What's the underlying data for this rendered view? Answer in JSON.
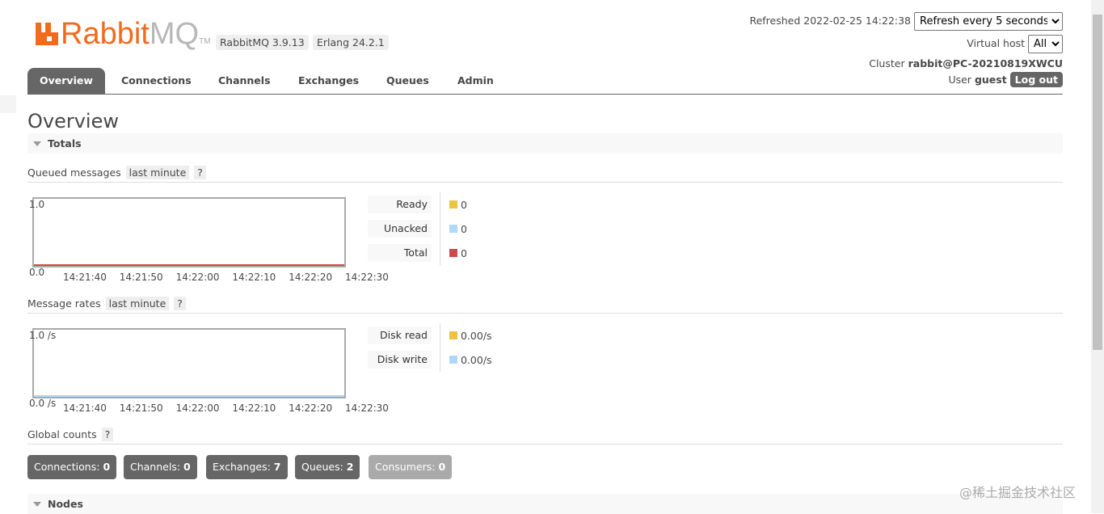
{
  "header": {
    "logo_text_a": "Rabbit",
    "logo_text_b": "MQ",
    "logo_tm": "TM",
    "rabbitmq_version": "RabbitMQ 3.9.13",
    "erlang_version": "Erlang 24.2.1",
    "refreshed": "Refreshed 2022-02-25 14:22:38",
    "refresh_select": "Refresh every 5 seconds",
    "vhost_label": "Virtual host",
    "vhost_select": "All",
    "cluster_label": "Cluster",
    "cluster_name": "rabbit@PC-20210819XWCU",
    "user_label": "User",
    "user_name": "guest",
    "logout": "Log out"
  },
  "tabs": [
    "Overview",
    "Connections",
    "Channels",
    "Exchanges",
    "Queues",
    "Admin"
  ],
  "page_title": "Overview",
  "totals": {
    "title": "Totals",
    "queued": {
      "label": "Queued messages",
      "range": "last minute",
      "help": "?",
      "ymax": "1.0",
      "ymin": "0.0",
      "xticks": [
        "14:21:40",
        "14:21:50",
        "14:22:00",
        "14:22:10",
        "14:22:20",
        "14:22:30"
      ],
      "legend": [
        {
          "label": "Ready",
          "value": "0",
          "color": "#edc240"
        },
        {
          "label": "Unacked",
          "value": "0",
          "color": "#afd8f8"
        },
        {
          "label": "Total",
          "value": "0",
          "color": "#cb4b4b"
        }
      ]
    },
    "rates": {
      "label": "Message rates",
      "range": "last minute",
      "help": "?",
      "ymax": "1.0 /s",
      "ymin": "0.0 /s",
      "xticks": [
        "14:21:40",
        "14:21:50",
        "14:22:00",
        "14:22:10",
        "14:22:20",
        "14:22:30"
      ],
      "legend": [
        {
          "label": "Disk read",
          "value": "0.00/s",
          "color": "#edc240"
        },
        {
          "label": "Disk write",
          "value": "0.00/s",
          "color": "#afd8f8"
        }
      ]
    },
    "global": {
      "label": "Global counts",
      "help": "?",
      "counts": [
        {
          "label": "Connections:",
          "value": "0"
        },
        {
          "label": "Channels:",
          "value": "0"
        },
        {
          "label": "Exchanges:",
          "value": "7"
        },
        {
          "label": "Queues:",
          "value": "2"
        },
        {
          "label": "Consumers:",
          "value": "0"
        }
      ]
    }
  },
  "nodes": {
    "title": "Nodes"
  },
  "watermark": "@稀土掘金技术社区"
}
